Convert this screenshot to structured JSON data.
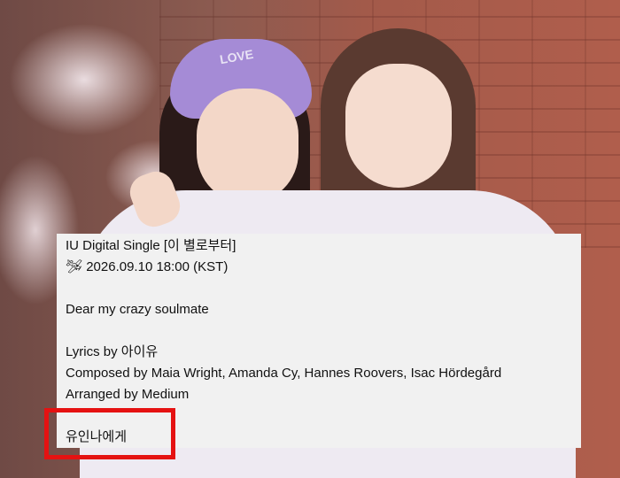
{
  "description": {
    "single_title": "IU Digital Single [이 별로부터]",
    "release_line": "🛩 2026.09.10 18:00 (KST)",
    "tagline": "Dear my crazy soulmate",
    "lyrics": "Lyrics by 아이유",
    "composed": "Composed by Maia Wright, Amanda Cy, Hannes Roovers, Isac Hördegård",
    "arranged": "Arranged by Medium",
    "dedication": "유인나에게"
  },
  "photo": {
    "beret_text": "LOVE"
  },
  "highlight": {
    "color": "#e51212"
  }
}
